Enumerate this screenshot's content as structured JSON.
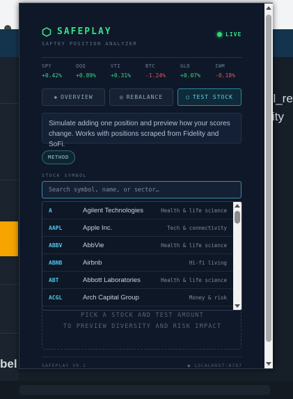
{
  "background": {
    "texts": [
      "al_re",
      "ity",
      "bel"
    ]
  },
  "header": {
    "title": "SAFEPLAY",
    "subtitle": "SAFTEY POSITION ANALYZER",
    "live": "LIVE",
    "accent": "#36e08a"
  },
  "tickers": [
    {
      "symbol": "SPY",
      "change": "+0.42%",
      "trend": "up"
    },
    {
      "symbol": "QQQ",
      "change": "+0.89%",
      "trend": "up"
    },
    {
      "symbol": "VTI",
      "change": "+0.31%",
      "trend": "up"
    },
    {
      "symbol": "BTC",
      "change": "-1.24%",
      "trend": "down"
    },
    {
      "symbol": "GLD",
      "change": "+0.07%",
      "trend": "up"
    },
    {
      "symbol": "IWM",
      "change": "-0.18%",
      "trend": "down"
    }
  ],
  "colors": {
    "up": "#36d98a",
    "down": "#e8545c"
  },
  "tabs": [
    {
      "label": "OVERVIEW",
      "icon": "diamond-icon",
      "active": false
    },
    {
      "label": "REBALANCE",
      "icon": "circle-dot-icon",
      "active": false
    },
    {
      "label": "TEST STOCK",
      "icon": "circle-icon",
      "active": true
    }
  ],
  "info": {
    "text": "Simulate adding one position and preview how your scores change. Works with positions scraped from Fidelity and SoFi."
  },
  "method": {
    "label": "METHOD"
  },
  "search": {
    "label": "STOCK SYMBOL",
    "placeholder": "Search symbol, name, or sector…",
    "value": ""
  },
  "dropdown": {
    "items": [
      {
        "symbol": "A",
        "name": "Agilent Technologies",
        "sector": "Health & life science"
      },
      {
        "symbol": "AAPL",
        "name": "Apple Inc.",
        "sector": "Tech & connectivity"
      },
      {
        "symbol": "ABBV",
        "name": "AbbVie",
        "sector": "Health & life science"
      },
      {
        "symbol": "ABNB",
        "name": "Airbnb",
        "sector": "Hi-fi living"
      },
      {
        "symbol": "ABT",
        "name": "Abbott Laboratories",
        "sector": "Health & life science"
      },
      {
        "symbol": "ACGL",
        "name": "Arch Capital Group",
        "sector": "Money & risk"
      }
    ]
  },
  "empty_state": {
    "line1": "PICK A STOCK AND TEST AMOUNT",
    "line2": "TO PREVIEW DIVERSITY AND RISK IMPACT"
  },
  "footer": {
    "version": "SAFEPLAY V0.1",
    "host": "● LOCALHOST:8787"
  }
}
